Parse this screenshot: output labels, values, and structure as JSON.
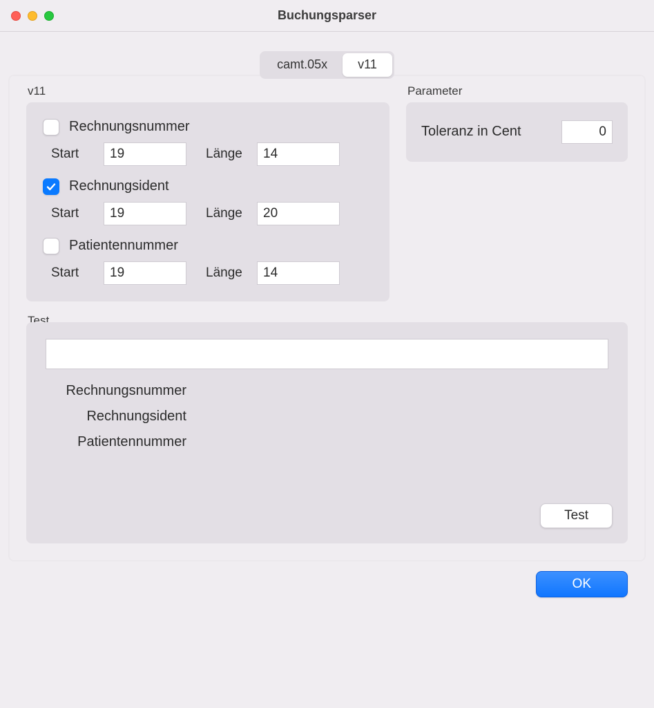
{
  "window": {
    "title": "Buchungsparser"
  },
  "tabs": {
    "t0": "camt.05x",
    "t1": "v11",
    "active": 1
  },
  "v11": {
    "legend": "v11",
    "labels": {
      "start": "Start",
      "length": "Länge"
    },
    "rechnungsnummer": {
      "label": "Rechnungsnummer",
      "checked": false,
      "start": "19",
      "length": "14"
    },
    "rechnungsident": {
      "label": "Rechnungsident",
      "checked": true,
      "start": "19",
      "length": "20"
    },
    "patientennummer": {
      "label": "Patientennummer",
      "checked": false,
      "start": "19",
      "length": "14"
    }
  },
  "parameter": {
    "legend": "Parameter",
    "tolerance_label": "Toleranz in Cent",
    "tolerance_value": "0"
  },
  "test": {
    "legend": "Test",
    "input": "",
    "rechnungsnummer_label": "Rechnungsnummer",
    "rechnungsident_label": "Rechnungsident",
    "patientennummer_label": "Patientennummer",
    "button": "Test"
  },
  "ok_button": "OK"
}
